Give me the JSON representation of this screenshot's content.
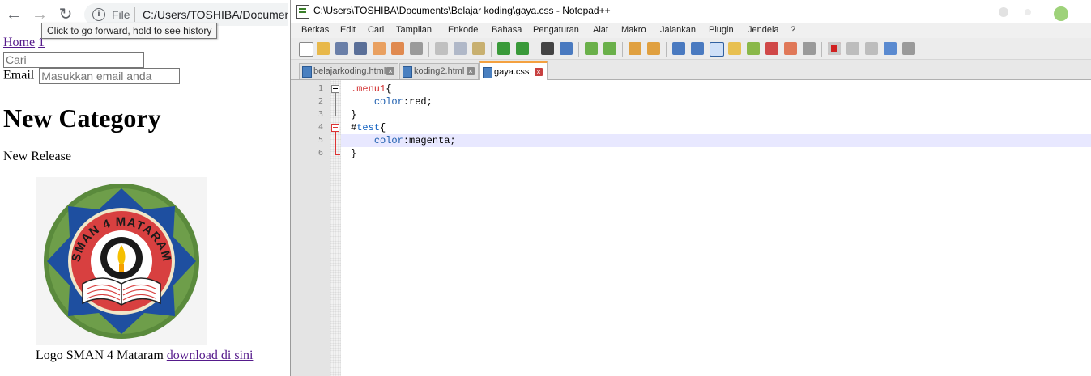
{
  "browser": {
    "omnibox": {
      "protocol_label": "File",
      "url": "C:/Users/TOSHIBA/Documents"
    },
    "tooltip": "Click to go forward, hold to see history",
    "page": {
      "nav_links": [
        "Home",
        "1"
      ],
      "search_placeholder": "Cari",
      "email_label": "Email",
      "email_placeholder": "Masukkan email anda",
      "heading": "New Category",
      "subheading": "New Release",
      "logo": {
        "top_text": "SMAN 4 MATARAM",
        "colors": {
          "outer_ring": "#5a8a3c",
          "petals": "#1e4fa0",
          "red_band": "#d84040",
          "flame": "#f5c000"
        }
      },
      "caption_text": "Logo SMAN 4 Mataram",
      "caption_link": "download di sini"
    }
  },
  "notepad": {
    "title": "C:\\Users\\TOSHIBA\\Documents\\Belajar koding\\gaya.css - Notepad++",
    "menu": [
      "Berkas",
      "Edit",
      "Cari",
      "Tampilan",
      "Enkode",
      "Bahasa",
      "Pengaturan",
      "Alat",
      "Makro",
      "Jalankan",
      "Plugin",
      "Jendela",
      "?"
    ],
    "toolbar_icons": [
      "new-file-icon",
      "open-file-icon",
      "save-icon",
      "save-all-icon",
      "close-icon",
      "close-all-icon",
      "print-icon",
      "cut-icon",
      "copy-icon",
      "paste-icon",
      "undo-icon",
      "redo-icon",
      "find-icon",
      "replace-icon",
      "zoom-in-icon",
      "zoom-out-icon",
      "sync-vertical-icon",
      "sync-horizontal-icon",
      "word-wrap-icon",
      "show-all-chars-icon",
      "indent-guide-icon",
      "user-language-icon",
      "doc-map-icon",
      "function-list-icon",
      "folder-workspace-icon",
      "monitoring-icon",
      "record-macro-icon",
      "stop-macro-icon",
      "play-macro-icon",
      "run-macro-multiple-icon",
      "save-macro-icon"
    ],
    "tabs": [
      {
        "label": "belajarkoding.html",
        "active": false
      },
      {
        "label": "koding2.html",
        "active": false
      },
      {
        "label": "gaya.css",
        "active": true
      }
    ],
    "line_numbers": [
      "1",
      "2",
      "3",
      "4",
      "5",
      "6"
    ],
    "code": {
      "l1_selector": ".menu1",
      "l1_brace": "{",
      "l2_indent": "    ",
      "l2_prop": "color",
      "l2_rest": ":red;",
      "l3": "}",
      "l4_hash": "#",
      "l4_selector": "test",
      "l4_brace": "{",
      "l5_indent": "    ",
      "l5_prop": "color",
      "l5_rest": ":magenta;",
      "l6": "}"
    },
    "current_line": 5
  }
}
